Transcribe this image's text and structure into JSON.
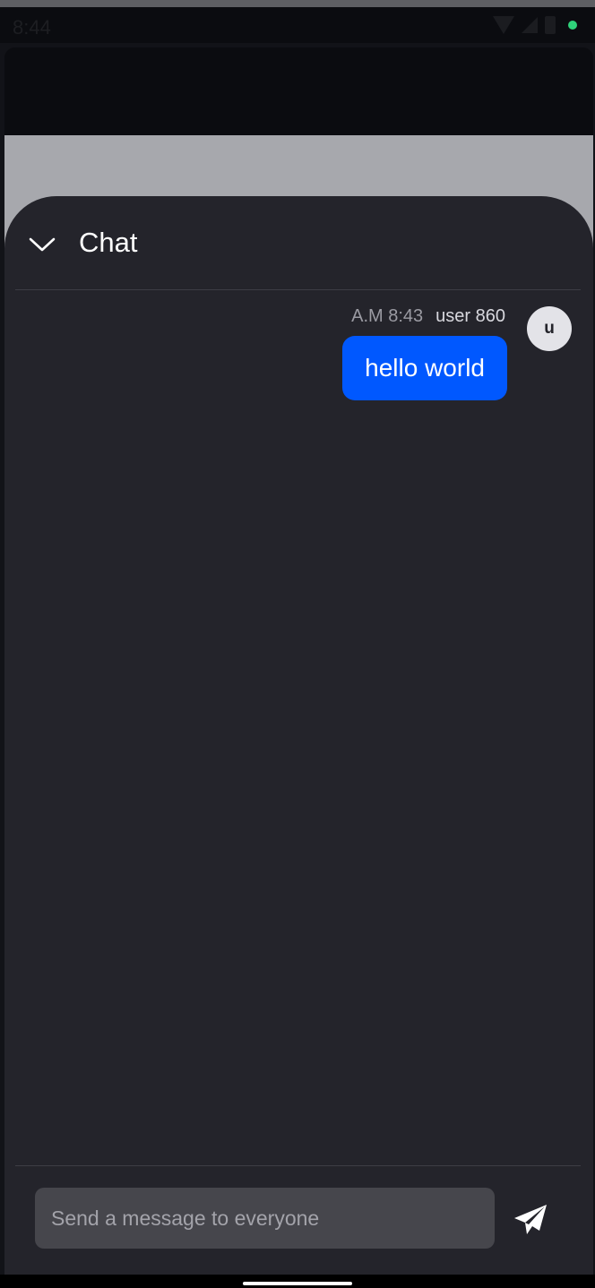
{
  "status_bar": {
    "time": "8:44",
    "icons": [
      "wifi-icon",
      "signal-icon",
      "battery-icon",
      "privacy-dot"
    ]
  },
  "chat": {
    "title": "Chat",
    "collapse_icon": "chevron-down-icon",
    "messages": [
      {
        "time": "A.M 8:43",
        "user": "user 860",
        "avatar_initial": "u",
        "text": "hello world"
      }
    ],
    "composer": {
      "placeholder": "Send a message to everyone",
      "value": "",
      "send_icon": "send-icon"
    }
  },
  "colors": {
    "sheet_background": "#24242b",
    "bubble": "#0058ff",
    "input_background": "#46464c",
    "scrim": "#a7a8ad"
  }
}
